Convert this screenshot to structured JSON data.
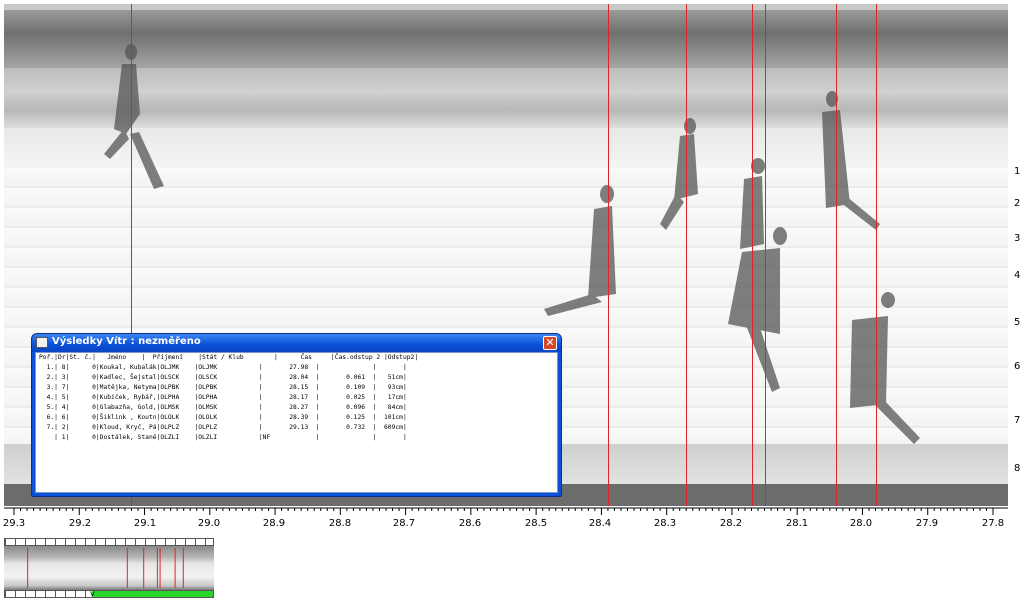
{
  "axis": {
    "tick_labels": [
      "29.3",
      "29.2",
      "29.1",
      "29.0",
      "28.9",
      "28.8",
      "28.7",
      "28.6",
      "28.5",
      "28.4",
      "28.3",
      "28.2",
      "28.1",
      "28.0",
      "27.9",
      "27.8"
    ]
  },
  "lanes": [
    "1",
    "2",
    "3",
    "4",
    "5",
    "6",
    "7",
    "8"
  ],
  "cursor_times": [
    29.12,
    28.39,
    28.27,
    28.17,
    28.15,
    28.04,
    27.98
  ],
  "results_window": {
    "title": "Výsledky  Vítr : nezměřeno",
    "close_label": "✕",
    "header": "Poř.|Dr|St. č.|   Jméno    |  Příjmení    |Stát / Klub        |      Čas     |Čas.odstup 2 |Odstup2|",
    "rows": [
      "  1.| 8|      0|Koukal, Kubalák|OLJMK    |OLJMK           |       27.98  |              |       |",
      "  2.| 3|      0|Kadlec, Šejstal|OLSCK    |OLSCK           |       28.04  |       0.061  |   51cm|",
      "  3.| 7|      0|Matějka, Netyma|OLPBK    |OLPBK           |       28.15  |       0.109  |   93cm|",
      "  4.| 5|      0|Kubíček, Rybář,|OLPHA    |OLPHA           |       28.17  |       0.025  |   17cm|",
      "  5.| 4|      0|Glabazňa, Gold,|OLMSK    |OLMSK           |       28.27  |       0.096  |   84cm|",
      "  6.| 6|      0|Šiklink , Koutn|OLOLK    |OLOLK           |       28.39  |       0.125  |  101cm|",
      "  7.| 2|      0|Kloud, Kryč, Pá|OLPLZ    |OLPLZ           |       29.13  |       0.732  |  609cm|",
      "    | 1|      0|Dostálek, Staně|OLZLI    |OLZLI           |NF            |              |       |"
    ]
  },
  "colors": {
    "cursor_line": "#d9262b",
    "titlebar": "#0a4fd6",
    "progress_green": "#2bd42b"
  },
  "icons": {
    "window_icon": "printer-icon",
    "close_icon": "close-icon"
  }
}
